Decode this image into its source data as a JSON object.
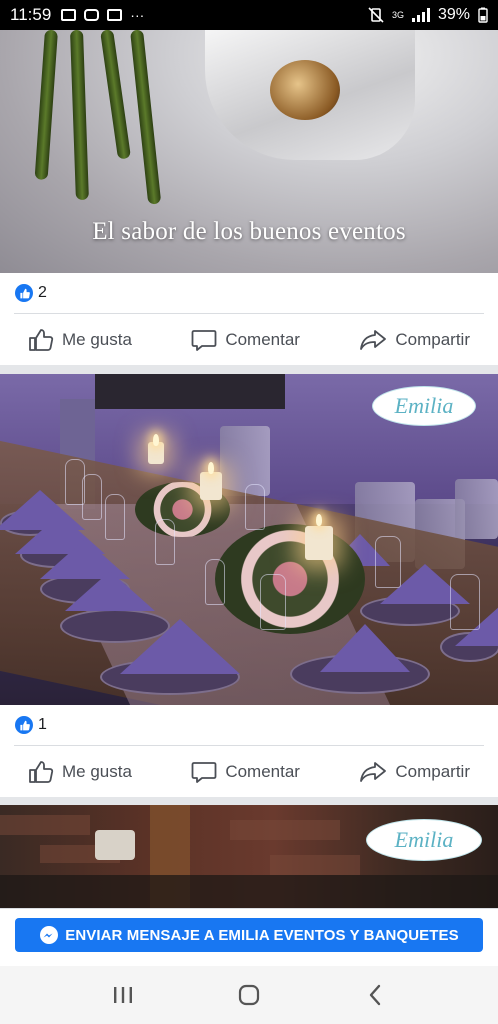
{
  "status_bar": {
    "time": "11:59",
    "dots": "···",
    "signal_label": "3G",
    "battery": "39%"
  },
  "posts": [
    {
      "image_caption": "El sabor de los buenos eventos",
      "reaction_count": "2",
      "actions": {
        "like": "Me gusta",
        "comment": "Comentar",
        "share": "Compartir"
      }
    },
    {
      "logo_text": "Emilia",
      "reaction_count": "1",
      "actions": {
        "like": "Me gusta",
        "comment": "Comentar",
        "share": "Compartir"
      }
    },
    {
      "logo_text": "Emilia"
    }
  ],
  "cta": {
    "label": "ENVIAR MENSAJE A EMILIA EVENTOS Y BANQUETES"
  },
  "colors": {
    "facebook_blue": "#1877f2",
    "action_gray": "#4b4f56"
  },
  "nav": [
    "recent-apps-icon",
    "home-icon",
    "back-icon"
  ]
}
